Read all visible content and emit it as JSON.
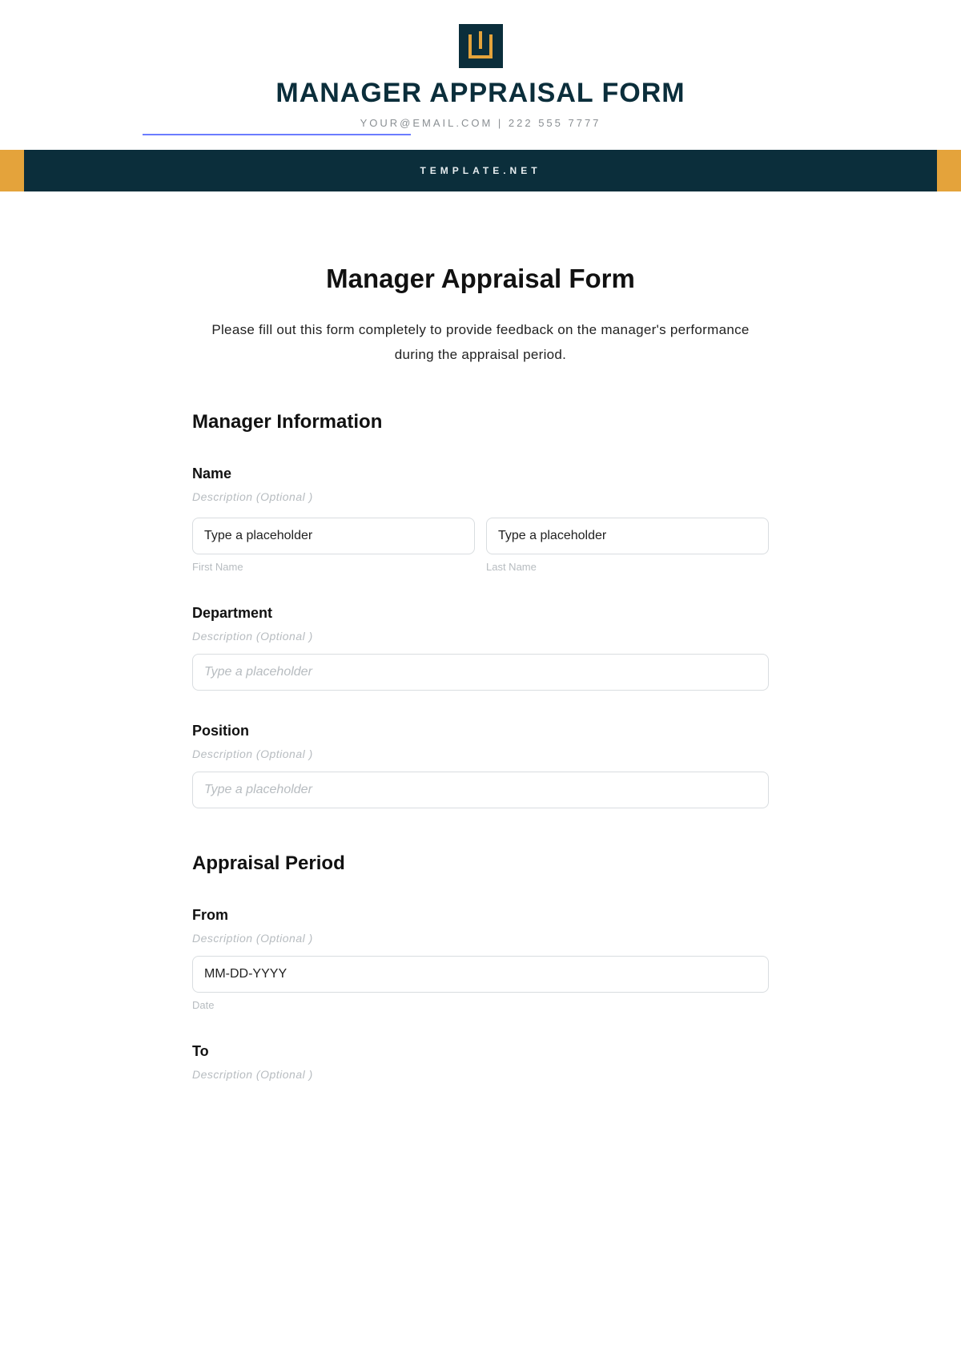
{
  "header": {
    "title": "MANAGER APPRAISAL FORM",
    "contact": "YOUR@EMAIL.COM | 222 555 7777",
    "band_text": "TEMPLATE.NET"
  },
  "form": {
    "title": "Manager Appraisal Form",
    "intro": "Please fill out this form completely to provide feedback on the manager's performance during the appraisal period.",
    "sections": {
      "manager_info": {
        "heading": "Manager Information",
        "name": {
          "label": "Name",
          "desc": "Description (Optional )",
          "first_placeholder": "Type a placeholder",
          "last_placeholder": "Type a placeholder",
          "first_sub": "First Name",
          "last_sub": "Last Name"
        },
        "department": {
          "label": "Department",
          "desc": "Description (Optional )",
          "placeholder": "Type a placeholder"
        },
        "position": {
          "label": "Position",
          "desc": "Description (Optional )",
          "placeholder": "Type a placeholder"
        }
      },
      "appraisal_period": {
        "heading": "Appraisal Period",
        "from": {
          "label": "From",
          "desc": "Description (Optional )",
          "placeholder": "MM-DD-YYYY",
          "sub": "Date"
        },
        "to": {
          "label": "To",
          "desc": "Description (Optional )"
        }
      }
    }
  }
}
